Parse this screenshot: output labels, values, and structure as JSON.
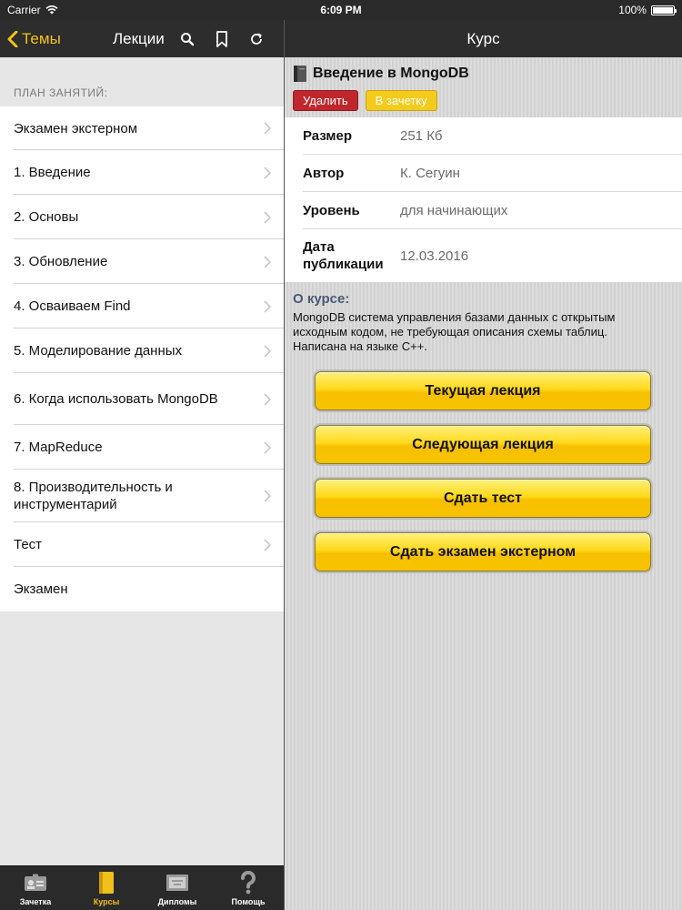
{
  "status_bar": {
    "carrier": "Carrier",
    "time": "6:09 PM",
    "battery": "100%"
  },
  "left_nav": {
    "back_label": "Темы",
    "title": "Лекции"
  },
  "lessons": {
    "section_header": "ПЛАН ЗАНЯТИЙ:",
    "items": [
      {
        "label": "Экзамен экстерном",
        "arrow": true
      },
      {
        "label": "1. Введение",
        "arrow": true
      },
      {
        "label": "2. Основы",
        "arrow": true
      },
      {
        "label": "3. Обновление",
        "arrow": true
      },
      {
        "label": "4. Осваиваем Find",
        "arrow": true
      },
      {
        "label": "5. Моделирование данных",
        "arrow": true
      },
      {
        "label": "6. Когда использовать MongoDB",
        "arrow": true
      },
      {
        "label": "7. MapReduce",
        "arrow": true
      },
      {
        "label": "8. Производительность и инструментарий",
        "arrow": true
      },
      {
        "label": "Тест",
        "arrow": true
      },
      {
        "label": "Экзамен",
        "arrow": false
      }
    ]
  },
  "tabbar": {
    "tabs": [
      {
        "label": "Зачетка",
        "icon": "id-card-icon",
        "active": false
      },
      {
        "label": "Курсы",
        "icon": "book-icon",
        "active": true
      },
      {
        "label": "Дипломы",
        "icon": "diploma-icon",
        "active": false
      },
      {
        "label": "Помощь",
        "icon": "question-icon",
        "active": false
      }
    ]
  },
  "right_nav": {
    "title": "Курс"
  },
  "course": {
    "title": "Введение в MongoDB",
    "delete_label": "Удалить",
    "record_label": "В зачетку",
    "info": [
      {
        "label": "Размер",
        "value": "251 Кб"
      },
      {
        "label": "Автор",
        "value": "К. Сегуин"
      },
      {
        "label": "Уровень",
        "value": "для начинающих"
      },
      {
        "label": "Дата публикации",
        "value": "12.03.2016"
      }
    ],
    "about_title": "О курсе:",
    "about_text": "MongoDB система управления базами данных с открытым исходным кодом, не требующая описания схемы таблиц. Написана на языке C++.",
    "buttons": {
      "current": "Текущая лекция",
      "next": "Следующая лекция",
      "test": "Сдать тест",
      "exam": "Сдать экзамен экстерном"
    }
  },
  "colors": {
    "accent": "#f3c21b",
    "nav_bg": "#2d2d2d",
    "delete": "#c0272d",
    "record": "#f4cb1c"
  }
}
